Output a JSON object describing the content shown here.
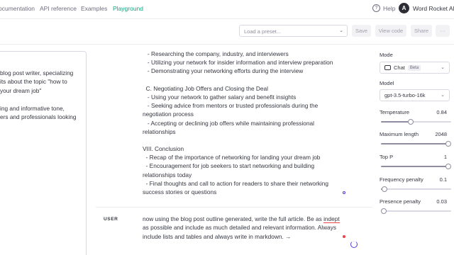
{
  "nav": {
    "documentation": "ocumentation",
    "api_reference": "API reference",
    "examples": "Examples",
    "playground": "Playground",
    "help": "Help",
    "avatar_initial": "A",
    "org_name": "Word Rocket AI"
  },
  "toolbar": {
    "preset_placeholder": "Load a preset...",
    "save": "Save",
    "view_code": "View code",
    "share": "Share",
    "more": "···"
  },
  "system_panel": {
    "lines": [
      "blog post writer, specializing",
      "its about the topic \"how to",
      "your dream job\"",
      "",
      "ing and informative tone,",
      "ers and professionals looking",
      "",
      "|"
    ]
  },
  "assistant_message": {
    "lines": [
      "   - Researching the company, industry, and interviewers",
      "   - Utilizing your network for insider information and interview preparation",
      "   - Demonstrating your networking efforts during the interview",
      "",
      "  C. Negotiating Job Offers and Closing the Deal",
      "   - Using your network to gather salary and benefit insights",
      "   - Seeking advice from mentors or trusted professionals during the",
      "negotiation process",
      "   - Accepting or declining job offers while maintaining professional",
      "relationships",
      "",
      "VIII. Conclusion",
      "  - Recap of the importance of networking for landing your dream job",
      "  - Encouragement for job seekers to start networking and building",
      "relationships today",
      "  - Final thoughts and call to action for readers to share their networking",
      "success stories or questions"
    ]
  },
  "user_message": {
    "role": "USER",
    "line1_before": "now using the blog post outline generated, write the full article. Be as ",
    "line1_typo": "indept",
    "line2": "as possible and include as much detailed and relevant information. Always",
    "line3": "include lists and tables and always write in markdown. →"
  },
  "settings": {
    "mode_label": "Mode",
    "mode_value": "Chat",
    "mode_badge": "Beta",
    "model_label": "Model",
    "model_value": "gpt-3.5-turbo-16k",
    "temperature_label": "Temperature",
    "temperature_value": "0.84",
    "temperature_level": 0.42,
    "max_length_label": "Maximum length",
    "max_length_value": "2048",
    "max_length_level": 1.0,
    "top_p_label": "Top P",
    "top_p_value": "1",
    "top_p_level": 1.0,
    "frequency_label": "Frequency penalty",
    "frequency_value": "0.1",
    "frequency_level": 0.05,
    "presence_label": "Presence penalty",
    "presence_value": "0.03",
    "presence_level": 0.015
  },
  "colors": {
    "accent": "#10a37f",
    "text": "#353740",
    "muted": "#6e6e80",
    "border": "#d9d9e3",
    "error": "#ef4146"
  }
}
